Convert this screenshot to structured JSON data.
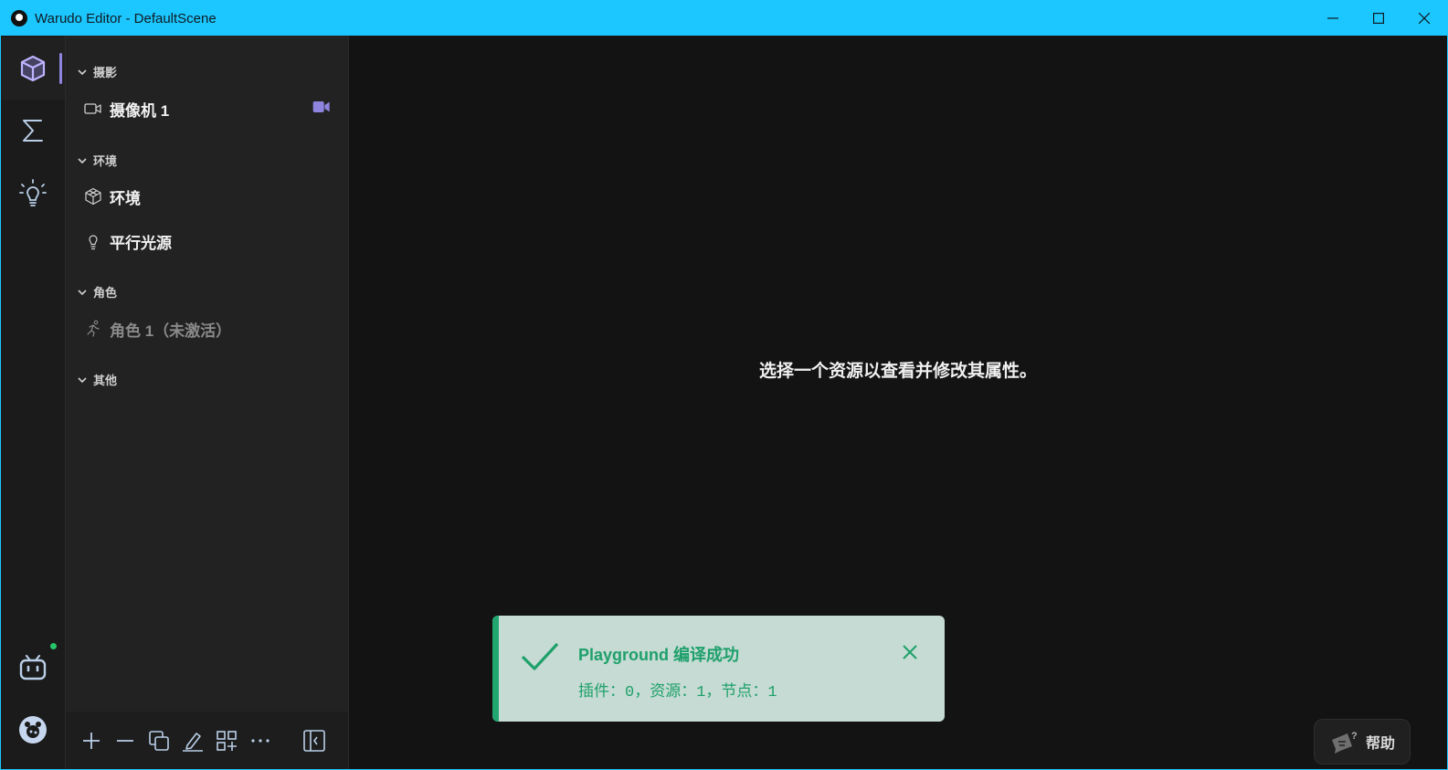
{
  "window": {
    "title": "Warudo Editor - DefaultScene"
  },
  "activity_bar": {
    "items": [
      {
        "name": "assets",
        "icon": "cube-icon",
        "active": true
      },
      {
        "name": "blueprints",
        "icon": "sigma-icon",
        "active": false
      },
      {
        "name": "plugins",
        "icon": "lightbulb-icon",
        "active": false
      }
    ],
    "bottom_items": [
      {
        "name": "bilibili",
        "icon": "tv-robot-icon",
        "badge": true
      },
      {
        "name": "warudo",
        "icon": "warudo-logo-icon"
      }
    ]
  },
  "asset_panel": {
    "sections": [
      {
        "label": "摄影",
        "items": [
          {
            "label": "摄像机 1",
            "icon": "camera-icon",
            "live": true
          }
        ]
      },
      {
        "label": "环境",
        "items": [
          {
            "label": "环境",
            "icon": "cube-outline-icon"
          },
          {
            "label": "平行光源",
            "icon": "bulb-icon"
          }
        ]
      },
      {
        "label": "角色",
        "items": [
          {
            "label": "角色 1（未激活）",
            "icon": "running-person-icon",
            "inactive": true
          }
        ]
      },
      {
        "label": "其他",
        "items": []
      }
    ],
    "toolbar": [
      "add-icon",
      "remove-icon",
      "duplicate-icon",
      "rename-icon",
      "add-grid-icon",
      "more-icon",
      "collapse-panel-icon"
    ]
  },
  "main": {
    "empty_message": "选择一个资源以查看并修改其属性。"
  },
  "toast": {
    "title": "Playground 编译成功",
    "body": "插件：0，资源：1，节点：1",
    "accent": "#22a66f"
  },
  "help": {
    "label": "帮助"
  },
  "colors": {
    "titlebar": "#1cc6ff",
    "accent": "#8f84e0",
    "success": "#22a66f"
  }
}
